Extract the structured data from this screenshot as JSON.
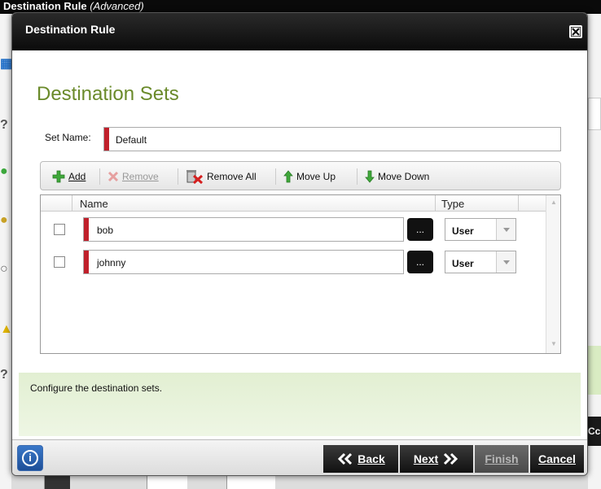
{
  "background": {
    "title": "Destination Rule",
    "title_suffix": "(Advanced)",
    "right_panel_text": "Cc"
  },
  "dialog": {
    "title": "Destination Rule",
    "section_title": "Destination Sets",
    "set_name_label": "Set Name:",
    "set_name_value": "Default",
    "toolbar": {
      "add_label": "Add",
      "remove_label": "Remove",
      "remove_all_label": "Remove All",
      "move_up_label": "Move Up",
      "move_down_label": "Move Down"
    },
    "grid": {
      "col_name": "Name",
      "col_type": "Type",
      "rows": [
        {
          "name": "bob",
          "browse_label": "...",
          "type": "User"
        },
        {
          "name": "johnny",
          "browse_label": "...",
          "type": "User"
        }
      ]
    },
    "info_text": "Configure the destination sets.",
    "footer": {
      "info_icon": "i",
      "back_label": "Back",
      "next_label": "Next",
      "finish_label": "Finish",
      "cancel_label": "Cancel"
    }
  },
  "colors": {
    "accent_green": "#6a8a2a",
    "required_red": "#c0202b",
    "info_panel": "#e2efd2"
  }
}
